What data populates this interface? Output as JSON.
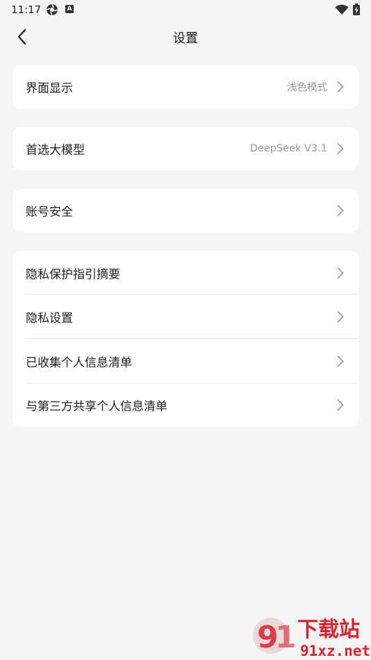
{
  "status_bar": {
    "time": "11:17",
    "badge_letter": "A"
  },
  "header": {
    "title": "设置"
  },
  "cards": [
    {
      "rows": [
        {
          "label": "界面显示",
          "value": "浅色模式"
        }
      ]
    },
    {
      "rows": [
        {
          "label": "首选大模型",
          "value": "DeepSeek V3.1"
        }
      ]
    },
    {
      "rows": [
        {
          "label": "账号安全",
          "value": ""
        }
      ]
    },
    {
      "rows": [
        {
          "label": "隐私保护指引摘要",
          "value": ""
        },
        {
          "label": "隐私设置",
          "value": ""
        },
        {
          "label": "已收集个人信息清单",
          "value": ""
        },
        {
          "label": "与第三方共享个人信息清单",
          "value": ""
        }
      ]
    }
  ],
  "watermark": {
    "brand": "下载站",
    "site": "91xz.net",
    "color": "#d9232d"
  },
  "colors": {
    "background": "#f5f5f5",
    "card": "#ffffff",
    "secondary_text": "#9a9a9a"
  }
}
